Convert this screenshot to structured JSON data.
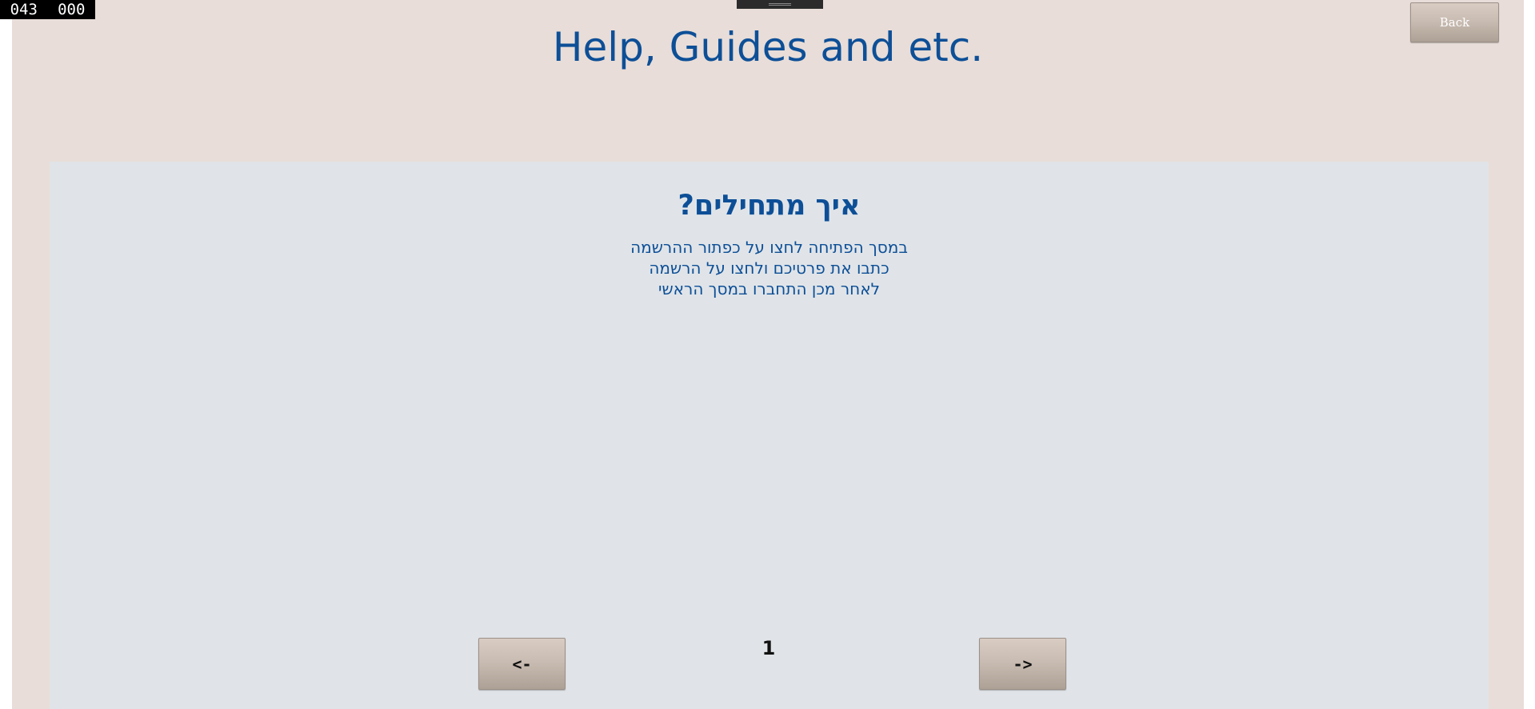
{
  "counter": {
    "left_value": "043",
    "right_value": "000"
  },
  "header": {
    "title": "Help, Guides and etc.",
    "back_label": "Back"
  },
  "content": {
    "heading": "איך מתחילים?",
    "lines": [
      "במסך הפתיחה לחצו על כפתור ההרשמה",
      "כתבו את פרטיכם ולחצו על הרשמה",
      "לאחר מכן התחברו במסך הראשי"
    ]
  },
  "pagination": {
    "prev_label": "<-",
    "next_label": "->",
    "current_page": "1"
  },
  "colors": {
    "background": "#e8ddd8",
    "panel": "#e0e4e8",
    "text_accent": "#0d4f97"
  }
}
